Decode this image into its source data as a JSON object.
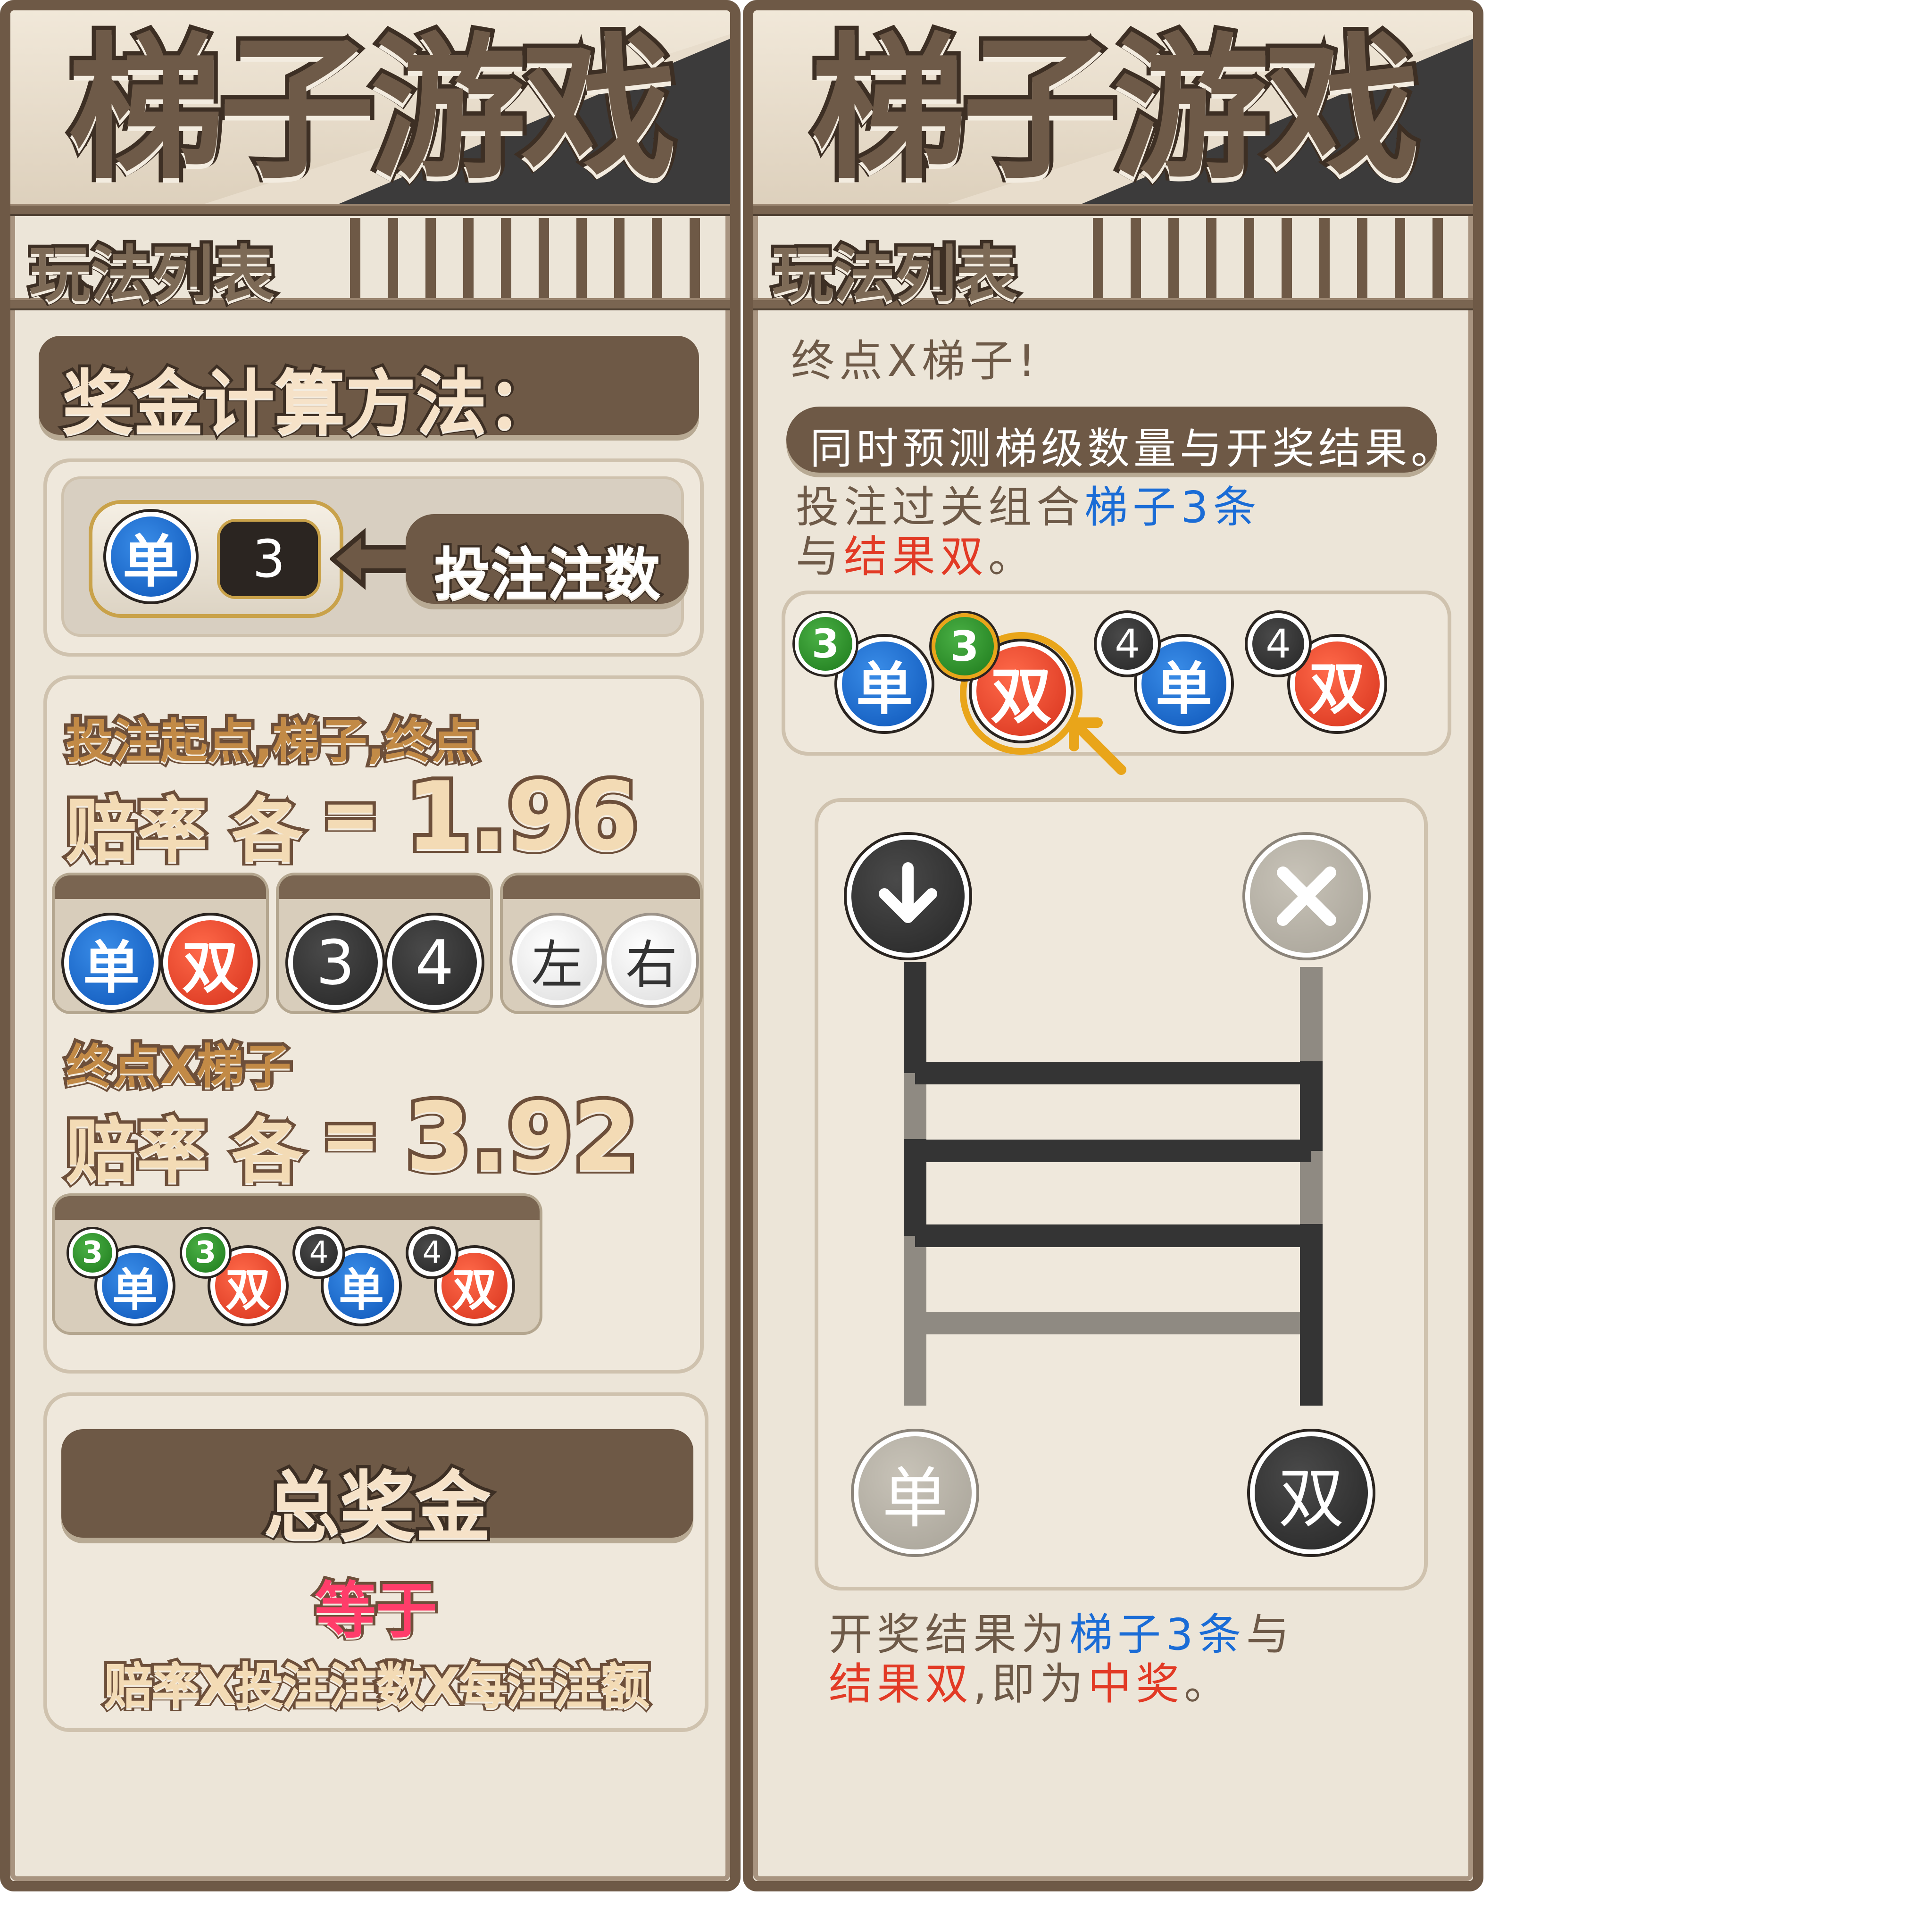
{
  "left_panel": {
    "title": "梯子游戏",
    "subtitle": "玩法列表",
    "header": "奖金计算方法：",
    "bet_example": {
      "ball_label": "单",
      "count": "3",
      "pointer_label": "投注注数"
    },
    "section1": {
      "label": "投注起点,梯子,终点",
      "odds_prefix": "赔率 各",
      "odds_value": "1.96"
    },
    "pairs": [
      [
        "单",
        "双"
      ],
      [
        "3",
        "4"
      ],
      [
        "左",
        "右"
      ]
    ],
    "section2": {
      "label": "终点X梯子",
      "odds_prefix": "赔率 各",
      "odds_value": "3.92"
    },
    "combos": [
      {
        "num": "3",
        "label": "单"
      },
      {
        "num": "3",
        "label": "双"
      },
      {
        "num": "4",
        "label": "单"
      },
      {
        "num": "4",
        "label": "双"
      }
    ],
    "total": {
      "title": "总奖金",
      "equals": "等于",
      "formula": "赔率X投注注数X每注注额"
    }
  },
  "right_panel": {
    "title": "梯子游戏",
    "subtitle": "玩法列表",
    "heading": "终点X梯子!",
    "banner": "同时预测梯级数量与开奖结果。",
    "desc_line1_prefix": "投注过关组合",
    "desc_line1_highlight": "梯子3条",
    "desc_line2_prefix": "与",
    "desc_line2_highlight": "结果双",
    "desc_line2_suffix": "。",
    "combos": [
      {
        "num": "3",
        "label": "单"
      },
      {
        "num": "3",
        "label": "双",
        "selected": true
      },
      {
        "num": "4",
        "label": "单"
      },
      {
        "num": "4",
        "label": "双"
      }
    ],
    "ladder": {
      "start_icon": "arrow-down-icon",
      "end_icon": "close-icon",
      "result_left": "单",
      "result_right": "双",
      "rungs": 3
    },
    "result_line1_prefix": "开奖结果为",
    "result_line1_highlight": "梯子3条",
    "result_line1_suffix": "与",
    "result_line2_highlight": "结果双",
    "result_line2_mid": ",即为",
    "result_line2_win": "中奖",
    "result_line2_suffix": "。"
  },
  "colors": {
    "brown": "#6e5946",
    "blue": "#1a6cd6",
    "red": "#e23a25",
    "panel_bg": "#ece5d8"
  }
}
